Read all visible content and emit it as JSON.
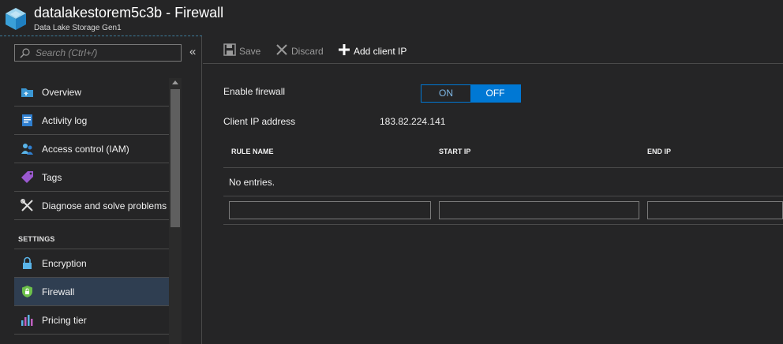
{
  "header": {
    "title": "datalakestorem5c3b - Firewall",
    "subtitle": "Data Lake Storage Gen1",
    "logo_icon": "data-lake-cube-icon"
  },
  "sidebar": {
    "search_placeholder": "Search (Ctrl+/)",
    "collapse_glyph": "«",
    "items": [
      {
        "label": "Overview",
        "icon": "overview-icon"
      },
      {
        "label": "Activity log",
        "icon": "activity-log-icon"
      },
      {
        "label": "Access control (IAM)",
        "icon": "access-control-icon"
      },
      {
        "label": "Tags",
        "icon": "tag-icon"
      },
      {
        "label": "Diagnose and solve problems",
        "icon": "wrench-icon"
      }
    ],
    "section_settings": "SETTINGS",
    "settings_items": [
      {
        "label": "Encryption",
        "icon": "lock-icon"
      },
      {
        "label": "Firewall",
        "icon": "shield-icon",
        "active": true
      },
      {
        "label": "Pricing tier",
        "icon": "pricing-chart-icon"
      }
    ]
  },
  "toolbar": {
    "save_label": "Save",
    "discard_label": "Discard",
    "add_client_ip_label": "Add client IP"
  },
  "firewall": {
    "enable_label": "Enable firewall",
    "toggle_on": "ON",
    "toggle_off": "OFF",
    "selected": "OFF",
    "client_ip_label": "Client IP address",
    "client_ip_value": "183.82.224.141"
  },
  "rules_table": {
    "columns": [
      "RULE NAME",
      "START IP",
      "END IP"
    ],
    "empty_text": "No entries.",
    "new_row": {
      "rule_name": "",
      "start_ip": "",
      "end_ip": ""
    }
  },
  "colors": {
    "background": "#252526",
    "accent": "#0078d4",
    "active_nav": "#2f3e51"
  }
}
